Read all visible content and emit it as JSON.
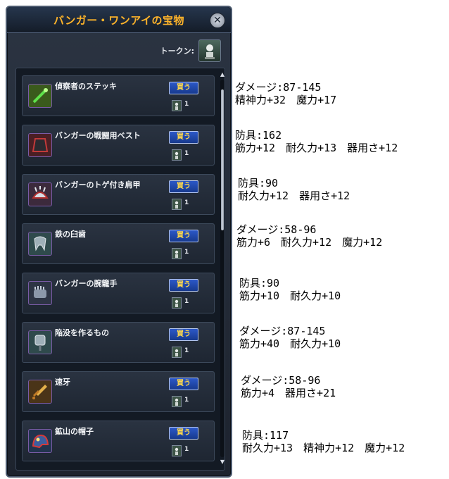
{
  "window": {
    "title": "バンガー・ワンアイの宝物",
    "close_glyph": "✕"
  },
  "token": {
    "label": "トークン:",
    "icon": "token-figure-icon"
  },
  "buy_label": "買う",
  "items": [
    {
      "name": "偵察者のステッキ",
      "qty": "1",
      "icon": "staff-icon",
      "icon_bg": "#3a5a1c",
      "stats_line1": "ダメージ:87-145",
      "stats_line2": "精神力+32　魔力+17"
    },
    {
      "name": "バンガーの戦闘用ベスト",
      "qty": "1",
      "icon": "vest-icon",
      "icon_bg": "#4b1f24",
      "stats_line1": "防具:162",
      "stats_line2": "筋力+12　耐久力+13　器用さ+12"
    },
    {
      "name": "バンガーのトゲ付き肩甲",
      "qty": "1",
      "icon": "spiked-shoulder-icon",
      "icon_bg": "#3c2a3c",
      "stats_line1": "防具:90",
      "stats_line2": "耐久力+12　器用さ+12"
    },
    {
      "name": "鉄の臼歯",
      "qty": "1",
      "icon": "iron-molar-icon",
      "icon_bg": "#2f4a4c",
      "stats_line1": "ダメージ:58-96",
      "stats_line2": "筋力+6　耐久力+12　魔力+12"
    },
    {
      "name": "バンガーの腕籠手",
      "qty": "1",
      "icon": "gauntlet-icon",
      "icon_bg": "#2d3444",
      "stats_line1": "防具:90",
      "stats_line2": "筋力+10　耐久力+10"
    },
    {
      "name": "陥没を作るもの",
      "qty": "1",
      "icon": "mace-icon",
      "icon_bg": "#2f4a4c",
      "stats_line1": "ダメージ:87-145",
      "stats_line2": "筋力+40　耐久力+10"
    },
    {
      "name": "速牙",
      "qty": "1",
      "icon": "dagger-icon",
      "icon_bg": "#4a3418",
      "stats_line1": "ダメージ:58-96",
      "stats_line2": "筋力+4　器用さ+21"
    },
    {
      "name": "鉱山の帽子",
      "qty": "1",
      "icon": "mining-helmet-icon",
      "icon_bg": "#22344e",
      "stats_line1": "防具:117",
      "stats_line2": "耐久力+13　精神力+12　魔力+12"
    }
  ],
  "colors": {
    "title": "#ffb42a",
    "buy_text": "#ffd84a",
    "buy_bg": "#2c58c8"
  }
}
